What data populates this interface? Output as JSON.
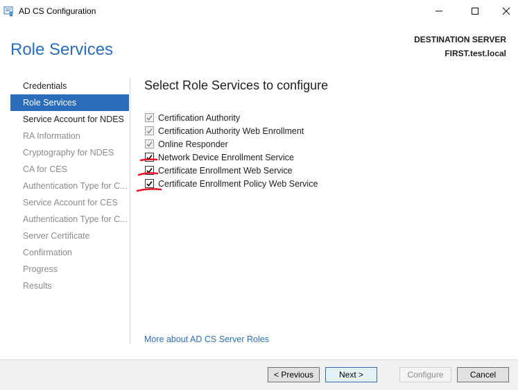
{
  "window": {
    "title": "AD CS Configuration",
    "icon": "certificate-app-icon"
  },
  "header": {
    "page_title": "Role Services",
    "destination_label": "DESTINATION SERVER",
    "destination_server": "FIRST.test.local"
  },
  "sidebar": {
    "items": [
      {
        "label": "Credentials",
        "state": "done"
      },
      {
        "label": "Role Services",
        "state": "active"
      },
      {
        "label": "Service Account for NDES",
        "state": "next"
      },
      {
        "label": "RA Information",
        "state": "disabled"
      },
      {
        "label": "Cryptography for NDES",
        "state": "disabled"
      },
      {
        "label": "CA for CES",
        "state": "disabled"
      },
      {
        "label": "Authentication Type for C...",
        "state": "disabled"
      },
      {
        "label": "Service Account for CES",
        "state": "disabled"
      },
      {
        "label": "Authentication Type for C...",
        "state": "disabled"
      },
      {
        "label": "Server Certificate",
        "state": "disabled"
      },
      {
        "label": "Confirmation",
        "state": "disabled"
      },
      {
        "label": "Progress",
        "state": "disabled"
      },
      {
        "label": "Results",
        "state": "disabled"
      }
    ]
  },
  "main": {
    "section_title": "Select Role Services to configure",
    "roles": [
      {
        "label": "Certification Authority",
        "checked": true,
        "enabled": false
      },
      {
        "label": "Certification Authority Web Enrollment",
        "checked": true,
        "enabled": false
      },
      {
        "label": "Online Responder",
        "checked": true,
        "enabled": false
      },
      {
        "label": "Network Device Enrollment Service",
        "checked": true,
        "enabled": true
      },
      {
        "label": "Certificate Enrollment Web Service",
        "checked": true,
        "enabled": true
      },
      {
        "label": "Certificate Enrollment Policy Web Service",
        "checked": true,
        "enabled": true
      }
    ],
    "more_link": "More about AD CS Server Roles"
  },
  "footer": {
    "previous_label": "< Previous",
    "next_label": "Next >",
    "configure_label": "Configure",
    "cancel_label": "Cancel"
  },
  "colors": {
    "accent": "#2a6ebb",
    "annotation": "#e81123"
  }
}
